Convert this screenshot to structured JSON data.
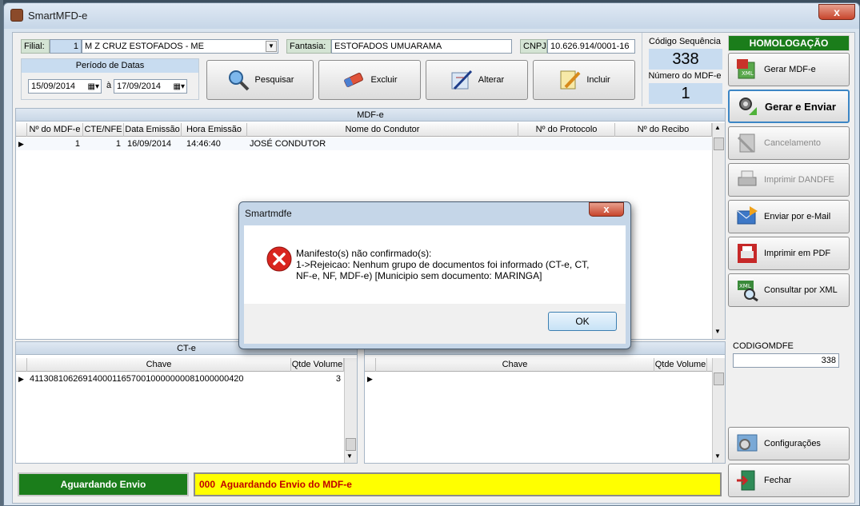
{
  "window": {
    "title": "SmartMFD-e",
    "close_glyph": "x"
  },
  "header": {
    "filial_label": "Filial:",
    "filial_code": "1",
    "filial_name": "M Z CRUZ ESTOFADOS - ME",
    "fantasia_label": "Fantasia:",
    "fantasia_value": "ESTOFADOS UMUARAMA",
    "cnpj_label": "CNPJ",
    "cnpj_value": "10.626.914/0001-16",
    "periodo_label": "Período de Datas",
    "date_from": "15/09/2014",
    "date_sep": "à",
    "date_to": "17/09/2014",
    "codigo_seq_label": "Código Sequência",
    "codigo_seq_value": "338",
    "numero_mdfe_label": "Número do MDF-e",
    "numero_mdfe_value": "1"
  },
  "actions": {
    "pesquisar": "Pesquisar",
    "excluir": "Excluir",
    "alterar": "Alterar",
    "incluir": "Incluir"
  },
  "mdfe_grid": {
    "title": "MDF-e",
    "columns": [
      "Nº do MDF-e",
      "CTE/NFE",
      "Data Emissão",
      "Hora Emissão",
      "Nome do Condutor",
      "Nº do Protocolo",
      "Nº do Recibo"
    ],
    "rows": [
      {
        "numero": "1",
        "cte_nfe": "1",
        "data": "16/09/2014",
        "hora": "14:46:40",
        "condutor": "JOSÉ CONDUTOR",
        "protocolo": "",
        "recibo": ""
      }
    ]
  },
  "cte_grid": {
    "title": "CT-e",
    "columns": [
      "Chave",
      "Qtde Volume"
    ],
    "rows": [
      {
        "chave": "41130810626914000116570010000000081000000420",
        "qtde": "3"
      }
    ]
  },
  "nfe_grid": {
    "columns": [
      "Chave",
      "Qtde Volume"
    ]
  },
  "sidebar": {
    "environment": "HOMOLOGAÇÃO",
    "buttons": [
      "Gerar MDF-e",
      "Gerar e Enviar",
      "Cancelamento",
      "Imprimir DANDFE",
      "Enviar por e-Mail",
      "Imprimir em PDF",
      "Consultar por XML"
    ],
    "codigo_label": "CODIGOMDFE",
    "codigo_value": "338",
    "config": "Configurações",
    "fechar": "Fechar"
  },
  "status": {
    "badge": "Aguardando Envio",
    "message": "000  Aguardando Envio do MDF-e"
  },
  "dialog": {
    "title": "Smartmdfe",
    "line1": "Manifesto(s) não confirmado(s):",
    "line2": "1->Rejeicao: Nenhum grupo de documentos foi informado (CT-e, CT,",
    "line3": "NF-e, NF, MDF-e) [Municipio sem documento: MARINGA]",
    "ok": "OK",
    "close_glyph": "x"
  },
  "colors": {
    "accent_green": "#1b7d1b",
    "status_yellow": "#ffff00",
    "status_text_red": "#c00000",
    "error_red": "#d9251f"
  }
}
